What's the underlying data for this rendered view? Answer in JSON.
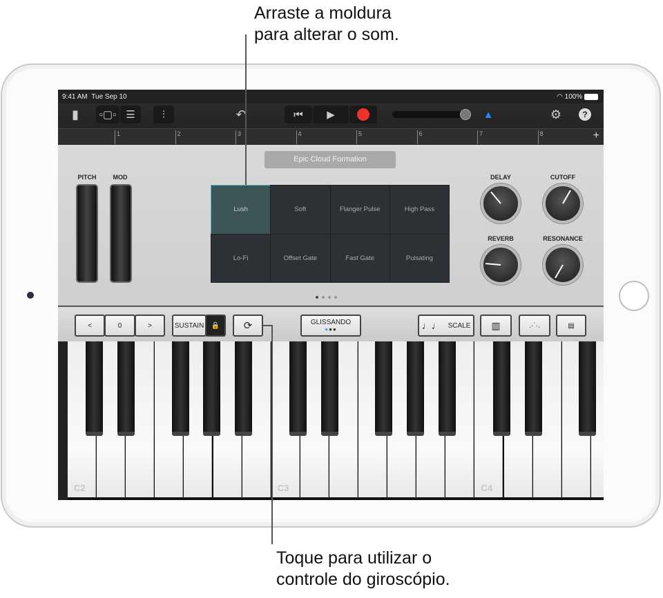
{
  "callouts": {
    "top": [
      "Arraste a moldura",
      "para alterar o som."
    ],
    "bottom": [
      "Toque para utilizar o",
      "controle do giroscópio."
    ]
  },
  "status": {
    "time": "9:41 AM",
    "date": "Tue Sep 10",
    "battery": "100%"
  },
  "toolbar": {
    "icons": [
      "document-icon",
      "tracks-view-icon",
      "list-view-icon",
      "mixer-icon",
      "undo-icon",
      "go-to-start-icon",
      "play-icon",
      "record-icon",
      "master-volume-slider",
      "metronome-icon",
      "settings-icon",
      "help-icon"
    ],
    "record_color": "#f0302a",
    "metronome_color": "#1a8cff"
  },
  "ruler": {
    "bars": [
      "1",
      "2",
      "3",
      "4",
      "5",
      "6",
      "7",
      "8"
    ],
    "add": "+"
  },
  "panel": {
    "preset": "Epic Cloud Formation",
    "pitch": "PITCH",
    "mod": "MOD",
    "pads": [
      "Lush",
      "Soft",
      "Flanger Pulse",
      "High Pass",
      "Lo-Fi",
      "Offset Gate",
      "Fast Gate",
      "Pulsating"
    ],
    "selected_pad": "Lush",
    "knobs": [
      {
        "label": "DELAY",
        "angle": -40
      },
      {
        "label": "CUTOFF",
        "angle": 30
      },
      {
        "label": "REVERB",
        "angle": -85
      },
      {
        "label": "RESONANCE",
        "angle": -150
      }
    ],
    "page_count": 4,
    "current_page": 1
  },
  "controls": {
    "prev": "<",
    "octave": "0",
    "next": ">",
    "sustain": "SUSTAIN",
    "glissando": "GLISSANDO",
    "scale": "SCALE",
    "accent": "#2fa8d8"
  },
  "keyboard": {
    "labels": {
      "C2": "C2",
      "C3": "C3",
      "C4": "C4"
    }
  }
}
